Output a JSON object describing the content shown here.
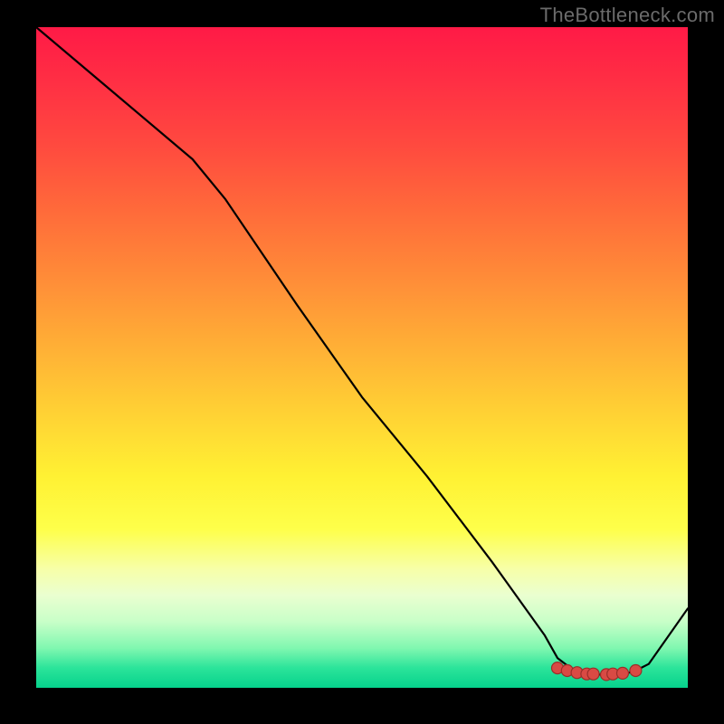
{
  "watermark": "TheBottleneck.com",
  "chart_data": {
    "type": "line",
    "title": "",
    "xlabel": "",
    "ylabel": "",
    "xlim": [
      0,
      100
    ],
    "ylim": [
      0,
      100
    ],
    "x": [
      0,
      12,
      24,
      29,
      40,
      50,
      60,
      70,
      78,
      80,
      82,
      84,
      86,
      88,
      90,
      92,
      94,
      100
    ],
    "values": [
      100,
      90,
      80,
      74,
      58,
      44,
      32,
      19,
      8,
      4.5,
      3,
      2.2,
      2.0,
      2.0,
      2.0,
      2.6,
      3.6,
      12
    ],
    "markers": {
      "x": [
        80.0,
        81.5,
        83.0,
        84.5,
        85.5,
        87.5,
        88.5,
        90.0,
        92.0
      ],
      "values": [
        3.0,
        2.6,
        2.3,
        2.1,
        2.1,
        2.0,
        2.1,
        2.2,
        2.6
      ]
    },
    "gradient_stops": [
      {
        "offset": 0,
        "color": "#ff1a46"
      },
      {
        "offset": 30,
        "color": "#ff7a38"
      },
      {
        "offset": 60,
        "color": "#ffe233"
      },
      {
        "offset": 85,
        "color": "#edffc0"
      },
      {
        "offset": 100,
        "color": "#06d28c"
      }
    ]
  }
}
